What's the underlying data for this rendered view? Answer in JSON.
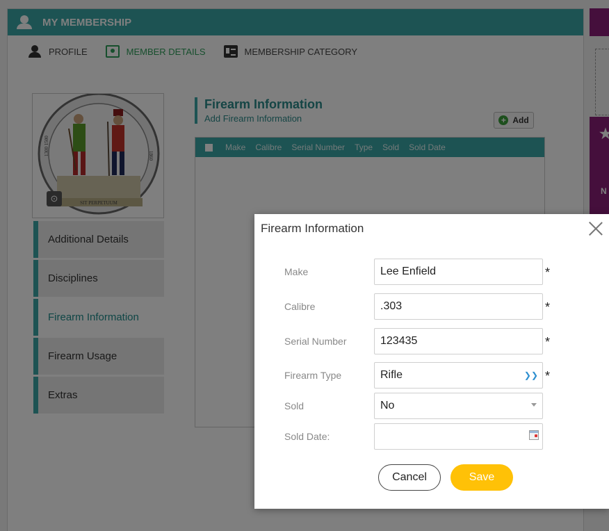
{
  "header": {
    "title": "MY MEMBERSHIP"
  },
  "nav": {
    "tabs": [
      {
        "label": "PROFILE",
        "icon": "person-icon",
        "active": false
      },
      {
        "label": "MEMBER DETAILS",
        "icon": "id-card-icon",
        "active": true
      },
      {
        "label": "MEMBERSHIP CATEGORY",
        "icon": "category-card-icon",
        "active": false
      }
    ]
  },
  "emblem": {
    "motto": "SIT PERPETUUM",
    "year_left": "1300 1500",
    "year_right": "1860"
  },
  "sidebar": {
    "items": [
      {
        "label": "Additional Details",
        "active": false
      },
      {
        "label": "Disciplines",
        "active": false
      },
      {
        "label": "Firearm Information",
        "active": true
      },
      {
        "label": "Firearm Usage",
        "active": false
      },
      {
        "label": "Extras",
        "active": false
      }
    ]
  },
  "section": {
    "title": "Firearm Information",
    "subtitle": "Add Firearm Information",
    "add_label": "Add"
  },
  "grid": {
    "columns": [
      "Make",
      "Calibre",
      "Serial Number",
      "Type",
      "Sold",
      "Sold Date"
    ]
  },
  "right_panel": {
    "letter": "N"
  },
  "modal": {
    "title": "Firearm Information",
    "fields": {
      "make": {
        "label": "Make",
        "value": "Lee Enfield",
        "required": "*"
      },
      "calibre": {
        "label": "Calibre",
        "value": ".303",
        "required": "*"
      },
      "serial": {
        "label": "Serial Number",
        "value": "123435",
        "required": "*"
      },
      "type": {
        "label": "Firearm Type",
        "value": "Rifle",
        "required": "*"
      },
      "sold": {
        "label": "Sold",
        "value": "No"
      },
      "sold_date": {
        "label": "Sold Date:",
        "value": ""
      }
    },
    "cancel_label": "Cancel",
    "save_label": "Save"
  },
  "colors": {
    "accent": "#3aa6a6",
    "active_tab": "#2e9e5b",
    "save": "#ffc107",
    "side_panel": "#8a1f78"
  }
}
